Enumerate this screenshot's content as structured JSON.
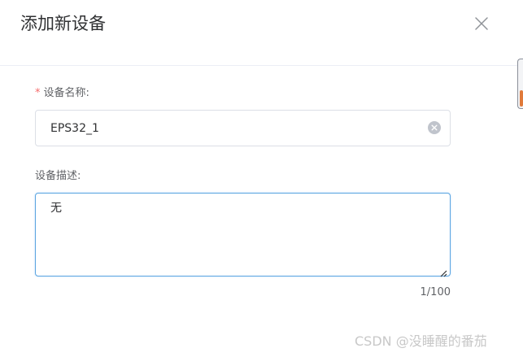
{
  "dialog": {
    "title": "添加新设备"
  },
  "form": {
    "name": {
      "required_mark": "*",
      "label": "设备名称:",
      "value": "EPS32_1"
    },
    "description": {
      "label": "设备描述:",
      "value": "无",
      "counter": "1/100"
    }
  },
  "icons": {
    "close": "close-icon",
    "clear": "circle-close-icon",
    "resize": "resize-handle-icon"
  },
  "colors": {
    "required": "#f56c6c",
    "focus_border": "#5ca5e0",
    "border": "#dcdfe6",
    "edge_accent": "#e07a3a"
  },
  "watermark": "CSDN @没睡醒的番茄"
}
